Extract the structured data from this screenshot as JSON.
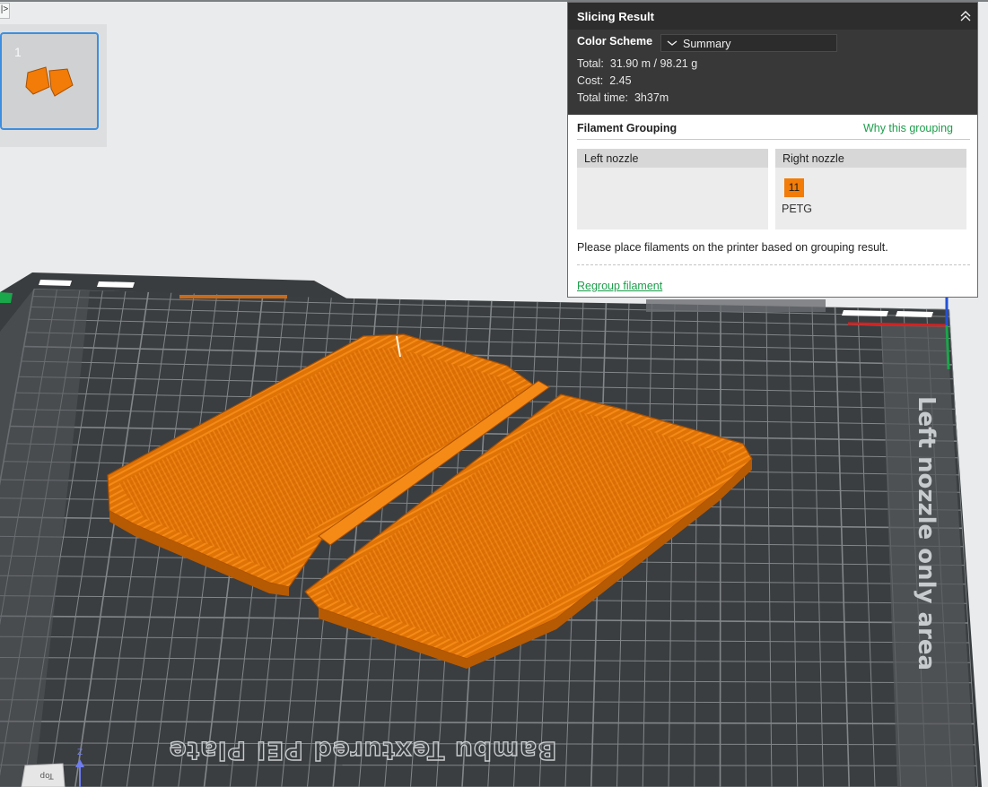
{
  "colors": {
    "model_orange": "#f27c07",
    "accent_green": "#1c9e4b",
    "selection_blue": "#3d8ee0",
    "panel_dark": "#383838",
    "bed_grid": "#3b3e41"
  },
  "expander": {
    "glyph": "|>",
    "icon": "expand-icon"
  },
  "plates": [
    {
      "number": "1",
      "selected": true
    }
  ],
  "slicing_result": {
    "title": "Slicing Result",
    "collapse_icon": "double-chevron-up-icon",
    "color_scheme_label": "Color Scheme",
    "color_scheme_value": "Summary",
    "total_label": "Total:",
    "total_value": "31.90 m / 98.21 g",
    "cost_label": "Cost:",
    "cost_value": "2.45",
    "time_label": "Total time:",
    "time_value": "3h37m"
  },
  "filament_grouping": {
    "title": "Filament Grouping",
    "why_link": "Why this grouping",
    "left_nozzle": {
      "label": "Left nozzle",
      "filaments": []
    },
    "right_nozzle": {
      "label": "Right nozzle",
      "filaments": [
        {
          "slot": "11",
          "type": "PETG",
          "color": "#f27c07"
        }
      ]
    },
    "note": "Please place filaments on the printer based on grouping result.",
    "regroup_link": "Regroup filament"
  },
  "scene": {
    "plate_text": "Bambu Textured PEI Plate",
    "zone_text": "Left nozzle only area",
    "axis_z_label": "Z",
    "view_cube_label": "Top"
  }
}
